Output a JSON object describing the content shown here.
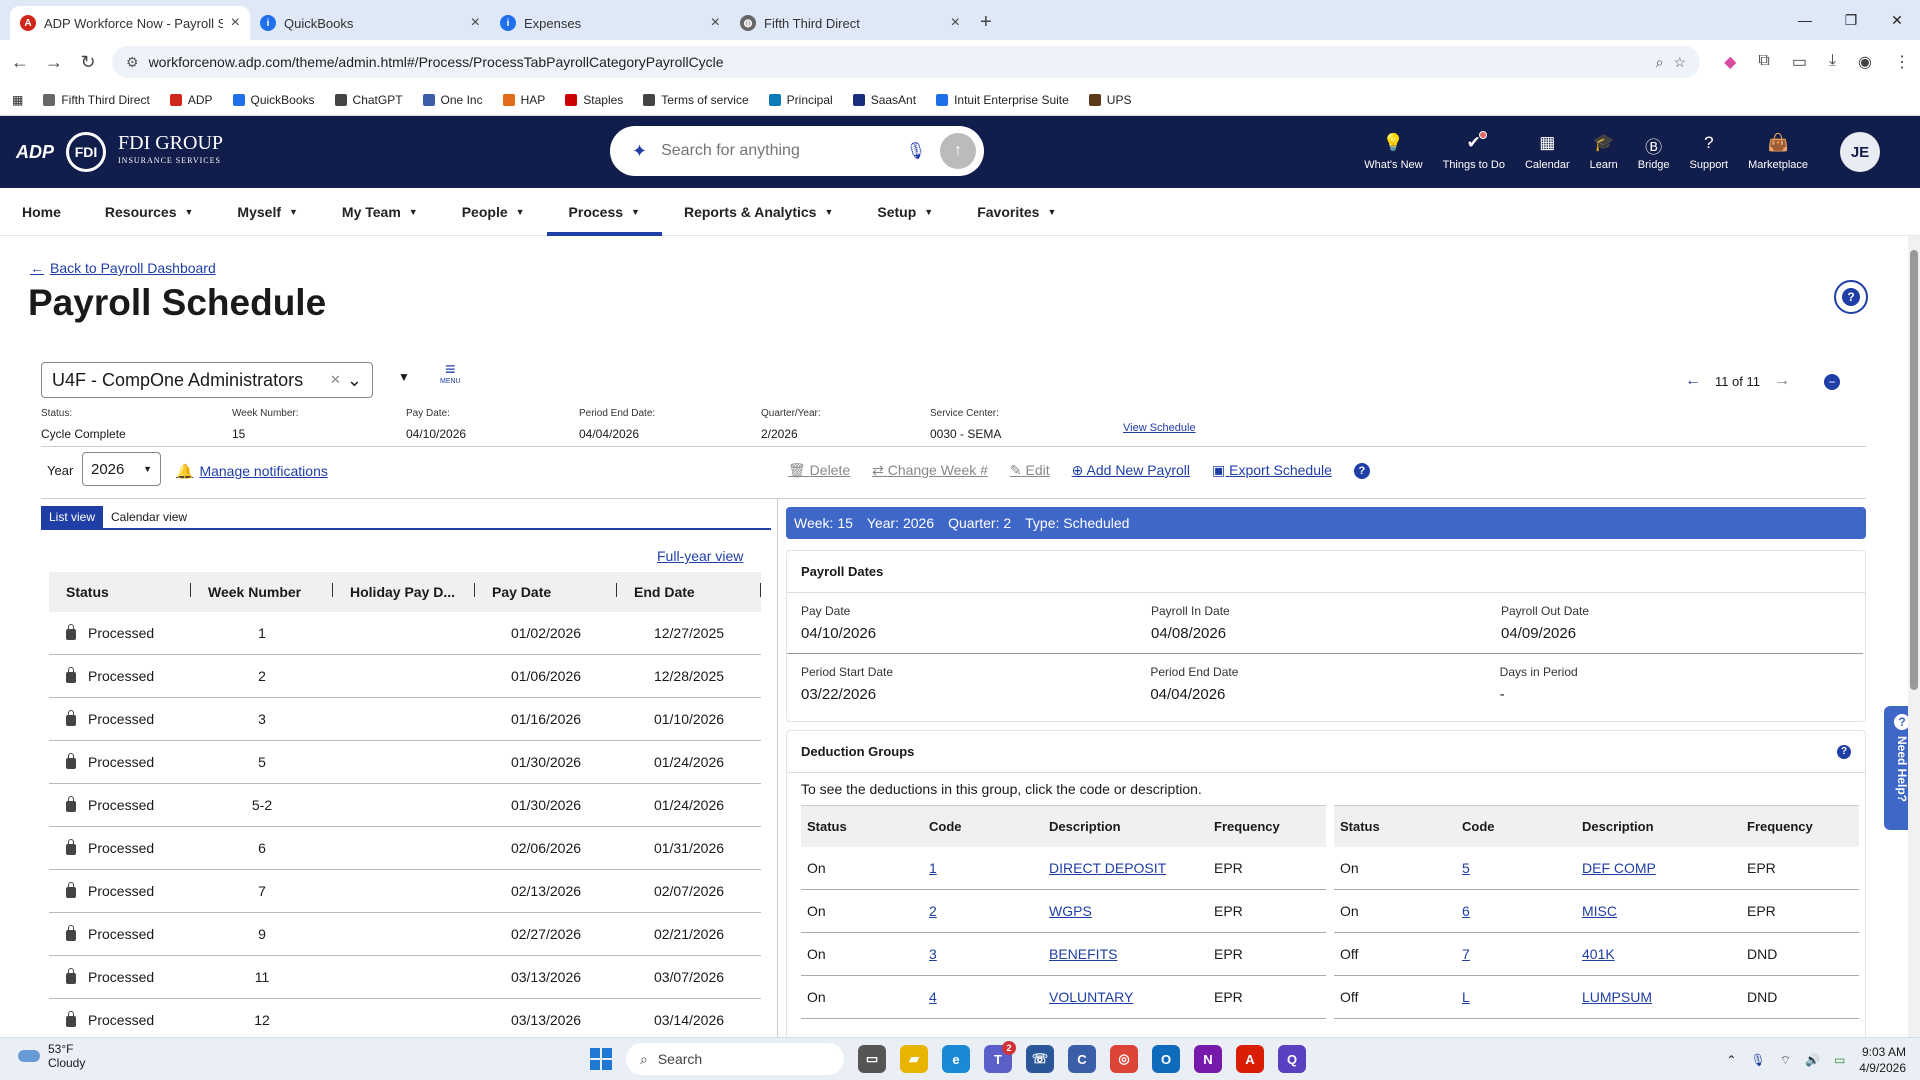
{
  "browser": {
    "tabs": [
      {
        "title": "ADP Workforce Now - Payroll S",
        "active": true,
        "icon": "adp-icon",
        "color": "#d0271d"
      },
      {
        "title": "QuickBooks",
        "active": false,
        "icon": "info-icon",
        "color": "#1f6feb"
      },
      {
        "title": "Expenses",
        "active": false,
        "icon": "info-icon",
        "color": "#1f6feb"
      },
      {
        "title": "Fifth Third Direct",
        "active": false,
        "icon": "globe-icon",
        "color": "#666666"
      }
    ],
    "url": "workforcenow.adp.com/theme/admin.html#/Process/ProcessTabPayrollCategoryPayrollCycle",
    "bookmarks": [
      {
        "label": "Fifth Third Direct",
        "color": "#666666"
      },
      {
        "label": "ADP",
        "color": "#d0271d"
      },
      {
        "label": "QuickBooks",
        "color": "#1f6feb"
      },
      {
        "label": "ChatGPT",
        "color": "#444444"
      },
      {
        "label": "One Inc",
        "color": "#3a5fa8"
      },
      {
        "label": "HAP",
        "color": "#e06b1a"
      },
      {
        "label": "Staples",
        "color": "#cc0000"
      },
      {
        "label": "Terms of service",
        "color": "#444444"
      },
      {
        "label": "Principal",
        "color": "#0a7bb8"
      },
      {
        "label": "SaasAnt",
        "color": "#1a2d7a"
      },
      {
        "label": "Intuit Enterprise Suite",
        "color": "#1f6feb"
      },
      {
        "label": "UPS",
        "color": "#5a3a1a"
      }
    ]
  },
  "header": {
    "brand_adp": "ADP",
    "brand_mark": "FDI",
    "brand_name": "FDI GROUP",
    "brand_sub": "INSURANCE SERVICES",
    "search_placeholder": "Search for anything",
    "icons": [
      {
        "label": "What's New",
        "icon": "lightbulb-icon",
        "glyph": "💡"
      },
      {
        "label": "Things to Do",
        "icon": "checklist-icon",
        "glyph": "✔"
      },
      {
        "label": "Calendar",
        "icon": "calendar-icon",
        "glyph": "▦"
      },
      {
        "label": "Learn",
        "icon": "graduation-cap-icon",
        "glyph": "🎓"
      },
      {
        "label": "Bridge",
        "icon": "bridge-icon",
        "glyph": "Ⓑ"
      },
      {
        "label": "Support",
        "icon": "question-icon",
        "glyph": "?"
      },
      {
        "label": "Marketplace",
        "icon": "shopping-bag-icon",
        "glyph": "👜"
      }
    ],
    "avatar": "JE"
  },
  "nav": [
    {
      "label": "Home",
      "dropdown": false,
      "active": false
    },
    {
      "label": "Resources",
      "dropdown": true,
      "active": false
    },
    {
      "label": "Myself",
      "dropdown": true,
      "active": false
    },
    {
      "label": "My Team",
      "dropdown": true,
      "active": false
    },
    {
      "label": "People",
      "dropdown": true,
      "active": false
    },
    {
      "label": "Process",
      "dropdown": true,
      "active": true
    },
    {
      "label": "Reports & Analytics",
      "dropdown": true,
      "active": false
    },
    {
      "label": "Setup",
      "dropdown": true,
      "active": false
    },
    {
      "label": "Favorites",
      "dropdown": true,
      "active": false
    }
  ],
  "page": {
    "back_link": "Back to Payroll Dashboard",
    "title": "Payroll Schedule",
    "company": "U4F - CompOne Administrators",
    "menu_label": "MENU",
    "pager": "11 of 11",
    "info": [
      {
        "label": "Status:",
        "value": "Cycle Complete"
      },
      {
        "label": "Week Number:",
        "value": "15"
      },
      {
        "label": "Pay Date:",
        "value": "04/10/2026"
      },
      {
        "label": "Period End Date:",
        "value": "04/04/2026"
      },
      {
        "label": "Quarter/Year:",
        "value": "2/2026"
      },
      {
        "label": "Service Center:",
        "value": "0030 - SEMA"
      }
    ],
    "view_schedule": "View Schedule",
    "year_label": "Year",
    "year": "2026",
    "manage_notifications": "Manage notifications",
    "actions": [
      {
        "label": "Delete",
        "enabled": false,
        "icon": "trash-icon",
        "glyph": "🗑"
      },
      {
        "label": "Change Week #",
        "enabled": false,
        "icon": "swap-icon",
        "glyph": "⇄"
      },
      {
        "label": "Edit",
        "enabled": false,
        "icon": "pencil-icon",
        "glyph": "✎"
      },
      {
        "label": "Add New Payroll",
        "enabled": true,
        "icon": "plus-circle-icon",
        "glyph": "⊕"
      },
      {
        "label": "Export Schedule",
        "enabled": true,
        "icon": "calendar-export-icon",
        "glyph": "▣"
      }
    ]
  },
  "list": {
    "tabs": [
      "List view",
      "Calendar view"
    ],
    "full_year_link": "Full-year view",
    "columns": [
      "Status",
      "Week Number",
      "Holiday Pay D...",
      "Pay Date",
      "End Date"
    ],
    "rows": [
      {
        "status": "Processed",
        "week": "1",
        "holiday": "",
        "pay_date": "01/02/2026",
        "end_date": "12/27/2025"
      },
      {
        "status": "Processed",
        "week": "2",
        "holiday": "",
        "pay_date": "01/06/2026",
        "end_date": "12/28/2025"
      },
      {
        "status": "Processed",
        "week": "3",
        "holiday": "",
        "pay_date": "01/16/2026",
        "end_date": "01/10/2026"
      },
      {
        "status": "Processed",
        "week": "5",
        "holiday": "",
        "pay_date": "01/30/2026",
        "end_date": "01/24/2026"
      },
      {
        "status": "Processed",
        "week": "5-2",
        "holiday": "",
        "pay_date": "01/30/2026",
        "end_date": "01/24/2026"
      },
      {
        "status": "Processed",
        "week": "6",
        "holiday": "",
        "pay_date": "02/06/2026",
        "end_date": "01/31/2026"
      },
      {
        "status": "Processed",
        "week": "7",
        "holiday": "",
        "pay_date": "02/13/2026",
        "end_date": "02/07/2026"
      },
      {
        "status": "Processed",
        "week": "9",
        "holiday": "",
        "pay_date": "02/27/2026",
        "end_date": "02/21/2026"
      },
      {
        "status": "Processed",
        "week": "11",
        "holiday": "",
        "pay_date": "03/13/2026",
        "end_date": "03/07/2026"
      },
      {
        "status": "Processed",
        "week": "12",
        "holiday": "",
        "pay_date": "03/13/2026",
        "end_date": "03/14/2026"
      }
    ]
  },
  "detail": {
    "week_bar": [
      "Week: 15",
      "Year: 2026",
      "Quarter: 2",
      "Type: Scheduled"
    ],
    "payroll_dates_title": "Payroll Dates",
    "payroll_dates": [
      [
        {
          "label": "Pay Date",
          "value": "04/10/2026"
        },
        {
          "label": "Payroll In Date",
          "value": "04/08/2026"
        },
        {
          "label": "Payroll Out Date",
          "value": "04/09/2026"
        }
      ],
      [
        {
          "label": "Period Start Date",
          "value": "03/22/2026"
        },
        {
          "label": "Period End Date",
          "value": "04/04/2026"
        },
        {
          "label": "Days in Period",
          "value": "-"
        }
      ]
    ],
    "deduction_title": "Deduction Groups",
    "deduction_note": "To see the deductions in this group, click the code or description.",
    "deduction_columns": [
      "Status",
      "Code",
      "Description",
      "Frequency"
    ],
    "deductions_left": [
      {
        "status": "On",
        "code": "1",
        "description": "DIRECT DEPOSIT",
        "frequency": "EPR"
      },
      {
        "status": "On",
        "code": "2",
        "description": "WGPS",
        "frequency": "EPR"
      },
      {
        "status": "On",
        "code": "3",
        "description": "BENEFITS",
        "frequency": "EPR"
      },
      {
        "status": "On",
        "code": "4",
        "description": "VOLUNTARY",
        "frequency": "EPR"
      }
    ],
    "deductions_right": [
      {
        "status": "On",
        "code": "5",
        "description": "DEF COMP",
        "frequency": "EPR"
      },
      {
        "status": "On",
        "code": "6",
        "description": "MISC",
        "frequency": "EPR"
      },
      {
        "status": "Off",
        "code": "7",
        "description": "401K",
        "frequency": "DND"
      },
      {
        "status": "Off",
        "code": "L",
        "description": "LUMPSUM",
        "frequency": "DND"
      }
    ],
    "need_help": "Need Help?"
  },
  "taskbar": {
    "temp": "53°F",
    "weather": "Cloudy",
    "search": "Search",
    "teams_badge": "2",
    "time": "9:03 AM",
    "date": "4/9/2026",
    "apps": [
      {
        "icon": "task-view-icon",
        "color": "#555555",
        "glyph": "▭"
      },
      {
        "icon": "file-explorer-icon",
        "color": "#e8b400",
        "glyph": "▰"
      },
      {
        "icon": "edge-icon",
        "color": "#1b8ad6",
        "glyph": "e"
      },
      {
        "icon": "teams-icon",
        "color": "#5b5fc7",
        "glyph": "T"
      },
      {
        "icon": "phone-link-icon",
        "color": "#2b579a",
        "glyph": "☏"
      },
      {
        "icon": "copilot-icon",
        "color": "#3a5fa8",
        "glyph": "C"
      },
      {
        "icon": "chrome-icon",
        "color": "#db4437",
        "glyph": "◎"
      },
      {
        "icon": "outlook-icon",
        "color": "#0f6cbd",
        "glyph": "O"
      },
      {
        "icon": "onenote-icon",
        "color": "#7719aa",
        "glyph": "N"
      },
      {
        "icon": "acrobat-icon",
        "color": "#d81e05",
        "glyph": "A"
      },
      {
        "icon": "clipchamp-icon",
        "color": "#5a3fc0",
        "glyph": "Q"
      }
    ]
  },
  "colors": {
    "navy": "#111d4a",
    "accent": "#1f3ea6",
    "weekbar": "#3f67c8"
  }
}
